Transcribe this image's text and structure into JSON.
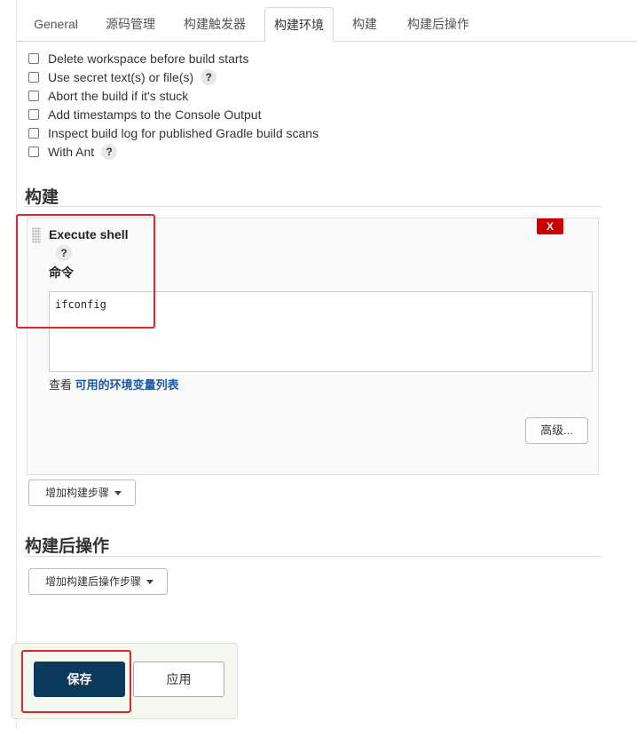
{
  "tabs": [
    {
      "label": "General"
    },
    {
      "label": "源码管理"
    },
    {
      "label": "构建触发器"
    },
    {
      "label": "构建环境"
    },
    {
      "label": "构建"
    },
    {
      "label": "构建后操作"
    }
  ],
  "build_env_options": [
    {
      "label": "Delete workspace before build starts",
      "checked": false
    },
    {
      "label": "Use secret text(s) or file(s)",
      "checked": false,
      "help": "?"
    },
    {
      "label": "Abort the build if it's stuck",
      "checked": false
    },
    {
      "label": "Add timestamps to the Console Output",
      "checked": false
    },
    {
      "label": "Inspect build log for published Gradle build scans",
      "checked": false
    },
    {
      "label": "With Ant",
      "checked": false,
      "help": "?"
    }
  ],
  "build_section": {
    "title": "构建",
    "step": {
      "title": "Execute shell",
      "help": "?",
      "delete_label": "X",
      "command_label": "命令",
      "command_value": "ifconfig",
      "env_prefix": "查看",
      "env_link": "可用的环境变量列表",
      "advanced_label": "高级..."
    },
    "add_step_label": "增加构建步骤"
  },
  "post_build_section": {
    "title": "构建后操作",
    "add_step_label": "增加构建后操作步骤"
  },
  "footer": {
    "save_label": "保存",
    "apply_label": "应用"
  },
  "colors": {
    "primary_button": "#0b3a5c",
    "delete_button": "#cc0000",
    "link": "#1d5aa7",
    "highlight_box": "#e0262a"
  }
}
